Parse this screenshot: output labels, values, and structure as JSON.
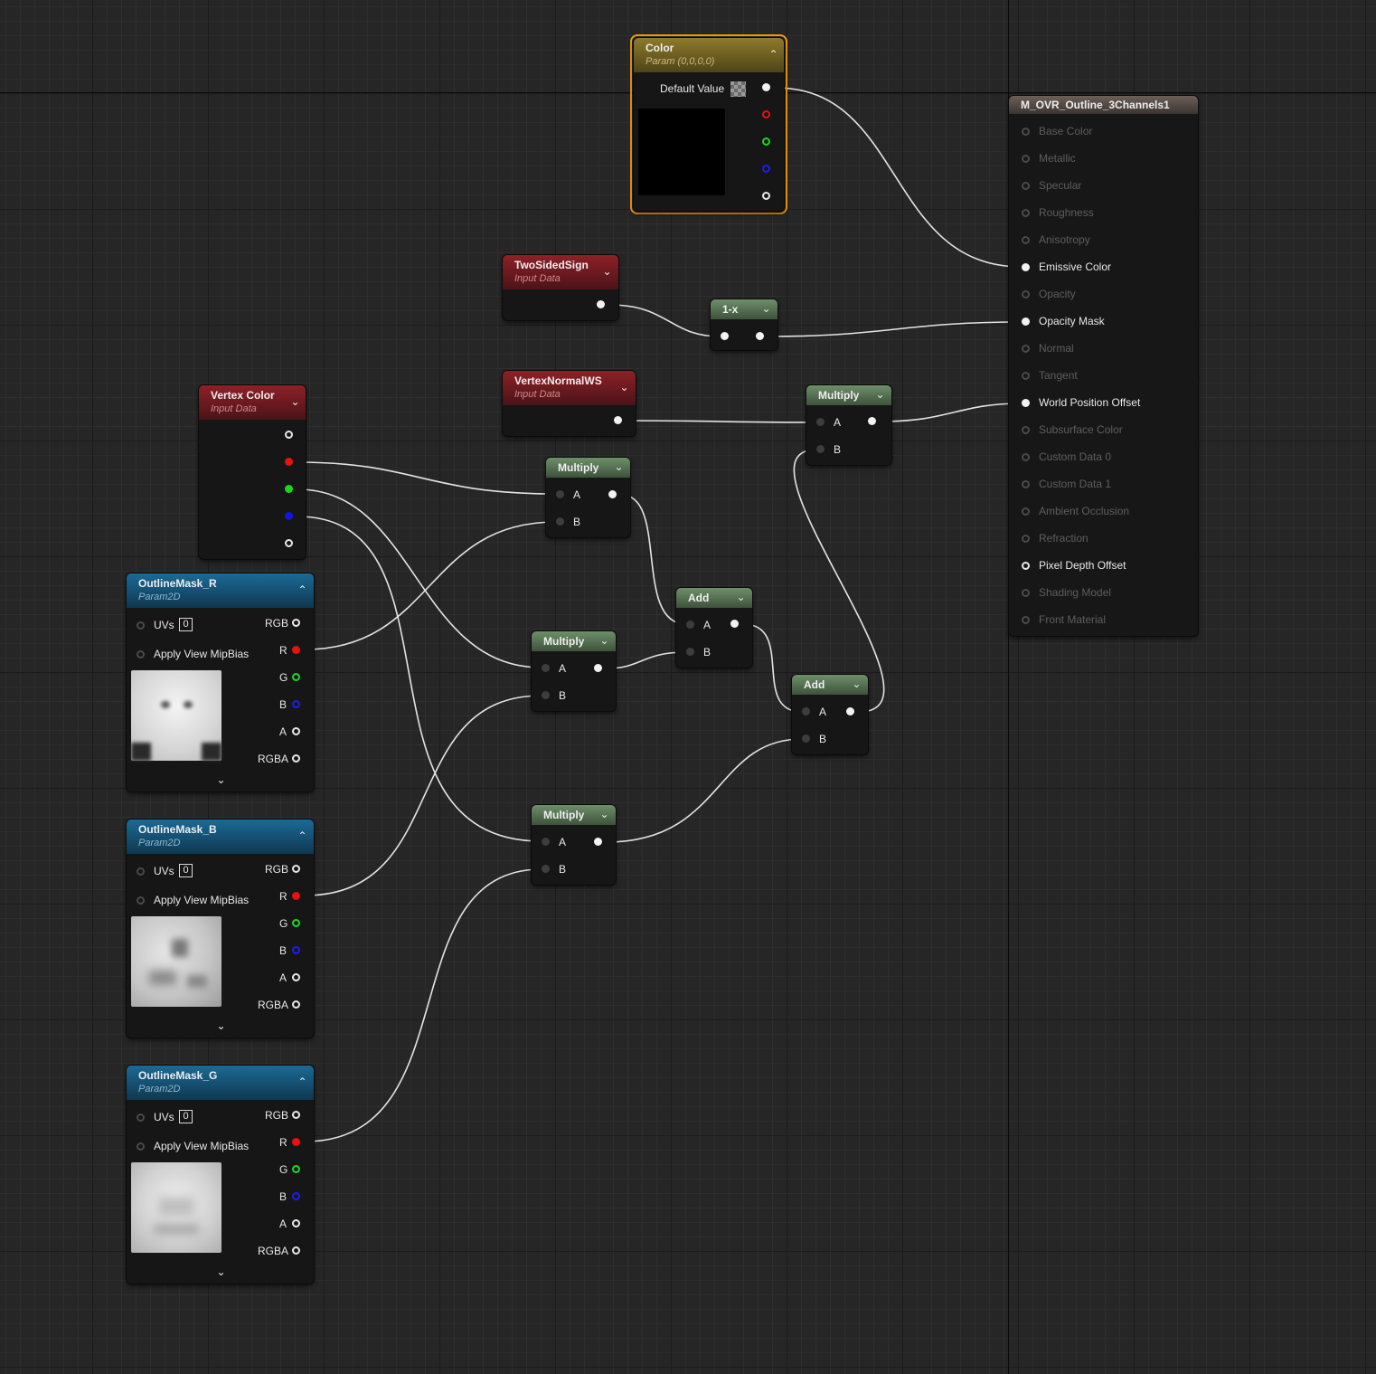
{
  "nodes": {
    "color": {
      "title": "Color",
      "subtitle": "Param (0,0,0,0)",
      "default_value_label": "Default Value"
    },
    "two_sided": {
      "title": "TwoSidedSign",
      "subtitle": "Input Data"
    },
    "one_minus": {
      "title": "1-x"
    },
    "vertex_normal": {
      "title": "VertexNormalWS",
      "subtitle": "Input Data"
    },
    "vertex_color": {
      "title": "Vertex Color",
      "subtitle": "Input Data"
    },
    "multiply_top": {
      "title": "Multiply",
      "a": "A",
      "b": "B"
    },
    "multiply_wpo": {
      "title": "Multiply",
      "a": "A",
      "b": "B"
    },
    "multiply_mid": {
      "title": "Multiply",
      "a": "A",
      "b": "B"
    },
    "multiply_bot": {
      "title": "Multiply",
      "a": "A",
      "b": "B"
    },
    "add_1": {
      "title": "Add",
      "a": "A",
      "b": "B"
    },
    "add_2": {
      "title": "Add",
      "a": "A",
      "b": "B"
    },
    "mask_r": {
      "title": "OutlineMask_R",
      "subtitle": "Param2D"
    },
    "mask_b": {
      "title": "OutlineMask_B",
      "subtitle": "Param2D"
    },
    "mask_g": {
      "title": "OutlineMask_G",
      "subtitle": "Param2D"
    },
    "texture_pins": {
      "uvs": "UVs",
      "uv_index": "0",
      "mip": "Apply View MipBias",
      "rgb": "RGB",
      "r": "R",
      "g": "G",
      "b": "B",
      "a": "A",
      "rgba": "RGBA"
    }
  },
  "result": {
    "title": "M_OVR_Outline_3Channels1",
    "pins": [
      {
        "label": "Base Color",
        "active": false
      },
      {
        "label": "Metallic",
        "active": false
      },
      {
        "label": "Specular",
        "active": false
      },
      {
        "label": "Roughness",
        "active": false
      },
      {
        "label": "Anisotropy",
        "active": false
      },
      {
        "label": "Emissive Color",
        "active": true,
        "connected": true
      },
      {
        "label": "Opacity",
        "active": false
      },
      {
        "label": "Opacity Mask",
        "active": true,
        "connected": true
      },
      {
        "label": "Normal",
        "active": false
      },
      {
        "label": "Tangent",
        "active": false
      },
      {
        "label": "World Position Offset",
        "active": true,
        "connected": true
      },
      {
        "label": "Subsurface Color",
        "active": false
      },
      {
        "label": "Custom Data 0",
        "active": false
      },
      {
        "label": "Custom Data 1",
        "active": false
      },
      {
        "label": "Ambient Occlusion",
        "active": false
      },
      {
        "label": "Refraction",
        "active": false
      },
      {
        "label": "Pixel Depth Offset",
        "active": true,
        "connected": false
      },
      {
        "label": "Shading Model",
        "active": false
      },
      {
        "label": "Front Material",
        "active": false
      }
    ]
  },
  "colors": {
    "selection": "#f39a10",
    "wire": "#e6e6e6",
    "input_header": "#8e2027",
    "param2d_header": "#1b6a96",
    "math_header": "#6e8f69",
    "param_header": "#8e7a2c"
  }
}
